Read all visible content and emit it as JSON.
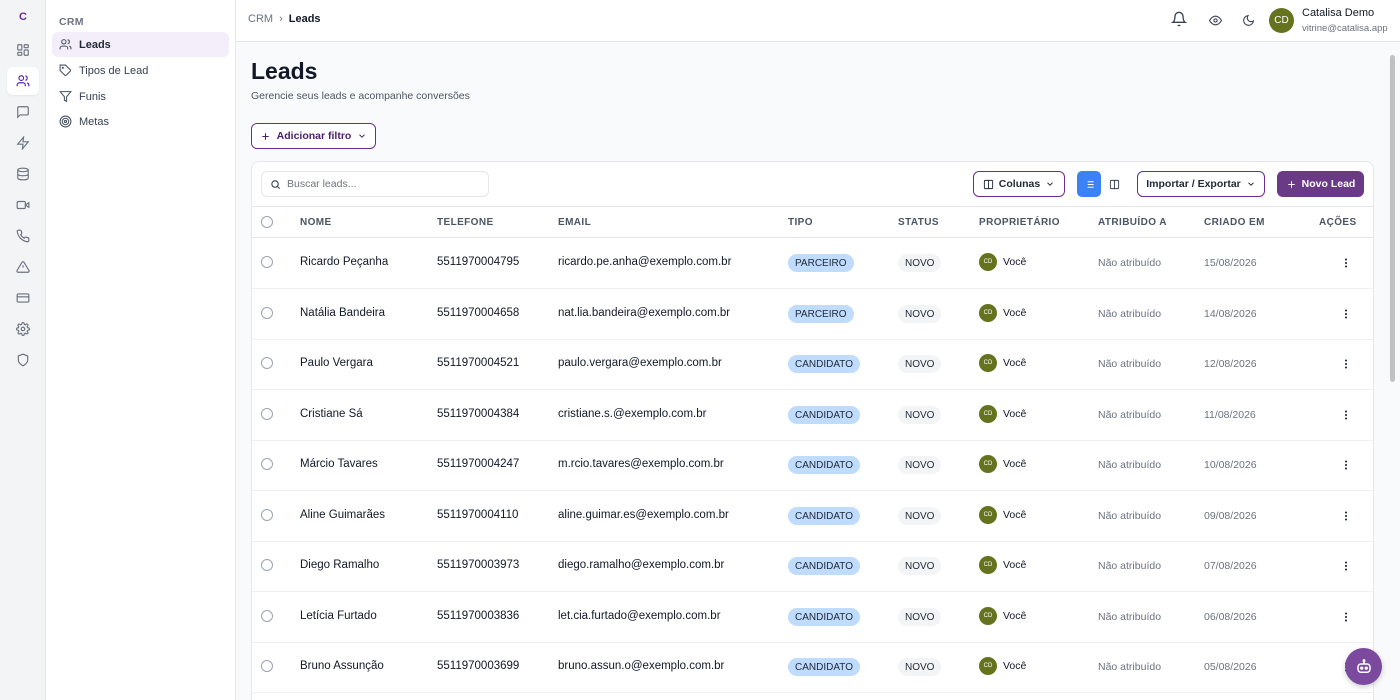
{
  "rail": {
    "logo": "C"
  },
  "sidebar": {
    "section": "CRM",
    "items": [
      {
        "label": "Leads",
        "icon": "users-icon",
        "active": true
      },
      {
        "label": "Tipos de Lead",
        "icon": "tag-icon"
      },
      {
        "label": "Funis",
        "icon": "filter-icon"
      },
      {
        "label": "Metas",
        "icon": "target-icon"
      }
    ]
  },
  "header": {
    "breadcrumb": [
      "CRM",
      "Leads"
    ],
    "user": {
      "name": "Catalisa Demo",
      "email": "vitrine@catalisa.app",
      "initials": "CD"
    }
  },
  "page": {
    "title": "Leads",
    "subtitle": "Gerencie seus leads e acompanhe conversões",
    "add_filter": "Adicionar filtro"
  },
  "toolbar": {
    "search_placeholder": "Buscar leads...",
    "columns": "Colunas",
    "import_export": "Importar / Exportar",
    "new_lead": "Novo Lead"
  },
  "table": {
    "headers": [
      "NOME",
      "TELEFONE",
      "EMAIL",
      "TIPO",
      "STATUS",
      "PROPRIETÁRIO",
      "ATRIBUÍDO A",
      "CRIADO EM",
      "AÇÕES"
    ],
    "rows": [
      {
        "nome": "Ricardo Peçanha",
        "telefone": "5511970004795",
        "email": "ricardo.pe.anha@exemplo.com.br",
        "tipo": "PARCEIRO",
        "status": "NOVO",
        "proprietario": "Você",
        "owner_initials": "CD",
        "atribuido": "Não atribuído",
        "criado": "15/08/2026"
      },
      {
        "nome": "Natália Bandeira",
        "telefone": "5511970004658",
        "email": "nat.lia.bandeira@exemplo.com.br",
        "tipo": "PARCEIRO",
        "status": "NOVO",
        "proprietario": "Você",
        "owner_initials": "CD",
        "atribuido": "Não atribuído",
        "criado": "14/08/2026"
      },
      {
        "nome": "Paulo Vergara",
        "telefone": "5511970004521",
        "email": "paulo.vergara@exemplo.com.br",
        "tipo": "CANDIDATO",
        "status": "NOVO",
        "proprietario": "Você",
        "owner_initials": "CD",
        "atribuido": "Não atribuído",
        "criado": "12/08/2026"
      },
      {
        "nome": "Cristiane Sá",
        "telefone": "5511970004384",
        "email": "cristiane.s.@exemplo.com.br",
        "tipo": "CANDIDATO",
        "status": "NOVO",
        "proprietario": "Você",
        "owner_initials": "CD",
        "atribuido": "Não atribuído",
        "criado": "11/08/2026"
      },
      {
        "nome": "Márcio Tavares",
        "telefone": "5511970004247",
        "email": "m.rcio.tavares@exemplo.com.br",
        "tipo": "CANDIDATO",
        "status": "NOVO",
        "proprietario": "Você",
        "owner_initials": "CD",
        "atribuido": "Não atribuído",
        "criado": "10/08/2026"
      },
      {
        "nome": "Aline Guimarães",
        "telefone": "5511970004110",
        "email": "aline.guimar.es@exemplo.com.br",
        "tipo": "CANDIDATO",
        "status": "NOVO",
        "proprietario": "Você",
        "owner_initials": "CD",
        "atribuido": "Não atribuído",
        "criado": "09/08/2026"
      },
      {
        "nome": "Diego Ramalho",
        "telefone": "5511970003973",
        "email": "diego.ramalho@exemplo.com.br",
        "tipo": "CANDIDATO",
        "status": "NOVO",
        "proprietario": "Você",
        "owner_initials": "CD",
        "atribuido": "Não atribuído",
        "criado": "07/08/2026"
      },
      {
        "nome": "Letícia Furtado",
        "telefone": "5511970003836",
        "email": "let.cia.furtado@exemplo.com.br",
        "tipo": "CANDIDATO",
        "status": "NOVO",
        "proprietario": "Você",
        "owner_initials": "CD",
        "atribuido": "Não atribuído",
        "criado": "06/08/2026"
      },
      {
        "nome": "Bruno Assunção",
        "telefone": "5511970003699",
        "email": "bruno.assun.o@exemplo.com.br",
        "tipo": "CANDIDATO",
        "status": "NOVO",
        "proprietario": "Você",
        "owner_initials": "CD",
        "atribuido": "Não atribuído",
        "criado": "05/08/2026"
      }
    ]
  },
  "colors": {
    "brand": "#6b3a86",
    "tipo_pill": "#bfdbfe",
    "avatar": "#65731f",
    "view_active": "#3b82f6"
  }
}
